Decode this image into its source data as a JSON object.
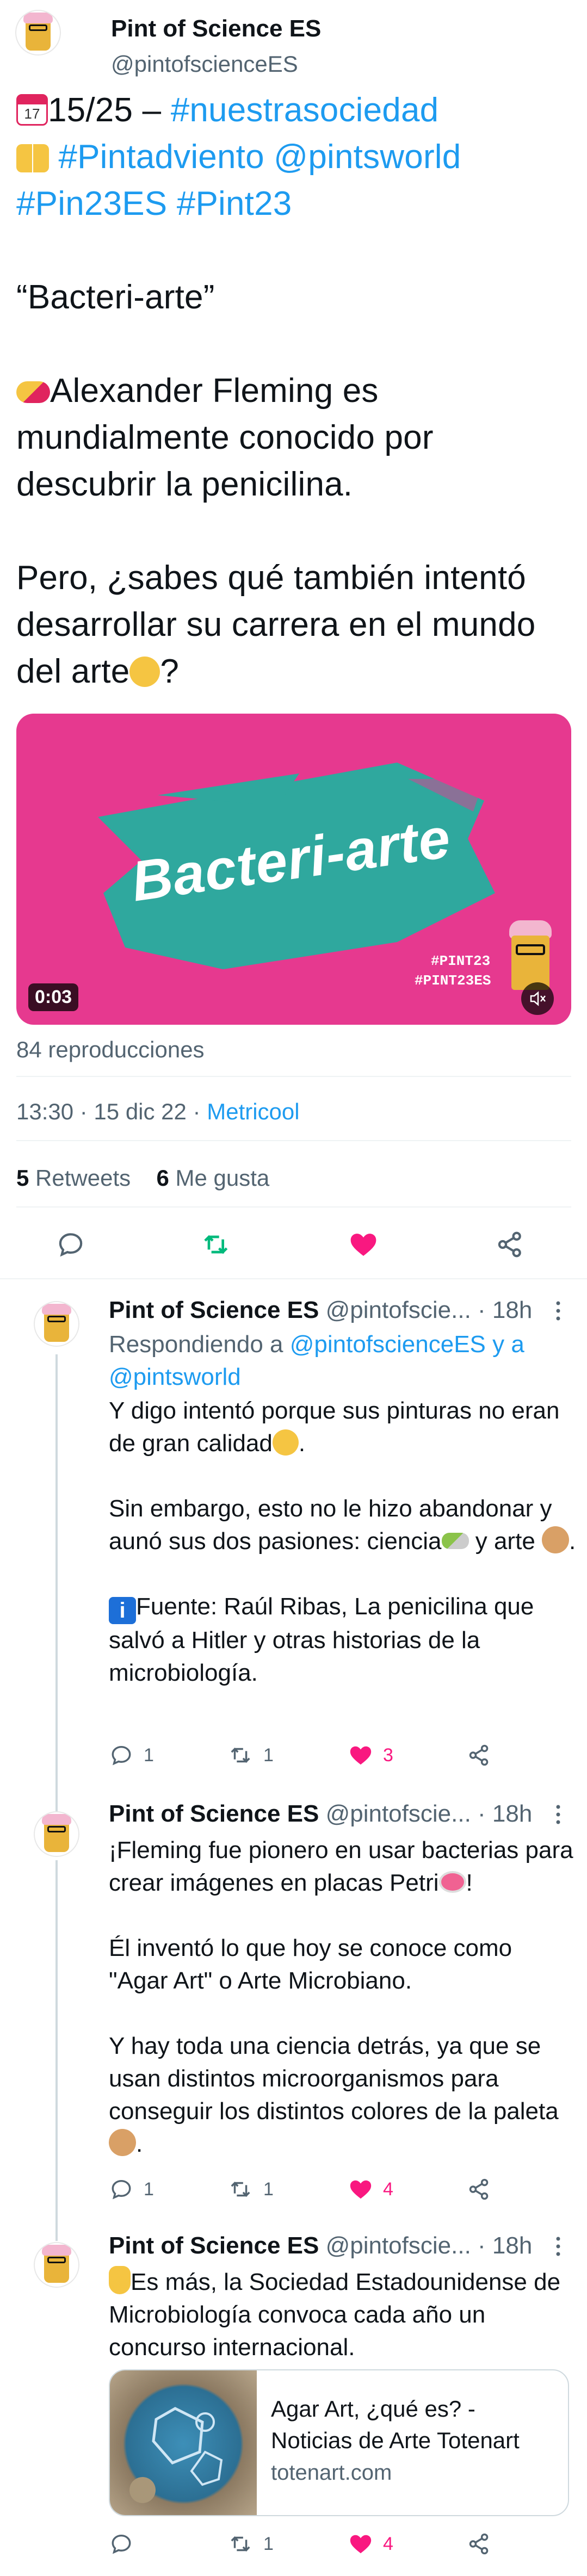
{
  "tweet": {
    "author_name": "Pint of Science ES",
    "author_handle": "@pintofscienceES",
    "line1_text": "15/25 – ",
    "line1_tag": "#nuestrasociedad",
    "line2_links": "#Pintadviento @pintsworld",
    "line3_links": "#Pin23ES #Pint23",
    "quote_title": "“Bacteri-arte”",
    "para1": "Alexander Fleming es mundialmente conocido por descubrir la penicilina.",
    "para2": "Pero, ¿sabes qué también intentó desarrollar su carrera en el mundo del arte",
    "para2_end": "?",
    "video_title": "Bacteri-arte",
    "video_tags_1": "#PINT23",
    "video_tags_2": "#PINT23ES",
    "video_time": "0:03",
    "views": "84 reproducciones",
    "time": "13:30 · 15 dic 22 · ",
    "source": "Metricool",
    "retweets_count": "5",
    "retweets_label": "Retweets",
    "likes_count": "6",
    "likes_label": "Me gusta"
  },
  "replies": [
    {
      "name": "Pint of Science ES",
      "handle": "@pintofscie...",
      "age": "· 18h",
      "replying_prefix": "Respondiendo a ",
      "replying_to": "@pintofscienceES y a @pintsworld",
      "p1": "Y digo intentó porque sus pinturas no eran de gran calidad",
      "p2": "Sin embargo, esto no le hizo abandonar y aunó sus dos pasiones: ciencia",
      "p2_mid": " y arte ",
      "p3": "Fuente: Raúl Ribas, La penicilina que salvó a Hitler y otras historias de la microbiología.",
      "replies_count": "1",
      "retweets_count": "1",
      "likes_count": "3"
    },
    {
      "name": "Pint of Science ES",
      "handle": "@pintofscie...",
      "age": "· 18h",
      "p1": "¡Fleming fue pionero en usar bacterias para crear imágenes en placas Petri",
      "p1_end": "!",
      "p2": "Él inventó lo que hoy se conoce como \"Agar Art\" o Arte Microbiano.",
      "p3": "Y hay toda una ciencia detrás, ya que se usan distintos microorganismos para conseguir los distintos colores de la paleta",
      "p3_end": ".",
      "replies_count": "1",
      "retweets_count": "1",
      "likes_count": "4"
    },
    {
      "name": "Pint of Science ES",
      "handle": "@pintofscie...",
      "age": "· 18h",
      "p1": "Es más, la Sociedad Estadounidense de Microbiología convoca cada año un concurso internacional.",
      "card_title": "Agar Art, ¿qué es? - Noticias de Arte Totenart",
      "card_domain": "totenart.com",
      "replies_count": "",
      "retweets_count": "1",
      "likes_count": "4"
    }
  ],
  "colors": {
    "link": "#1d9bf0",
    "retweet_green": "#00ba7c",
    "like_pink": "#f91880",
    "video_bg": "#e6398f",
    "video_brush": "#2fa89e"
  }
}
